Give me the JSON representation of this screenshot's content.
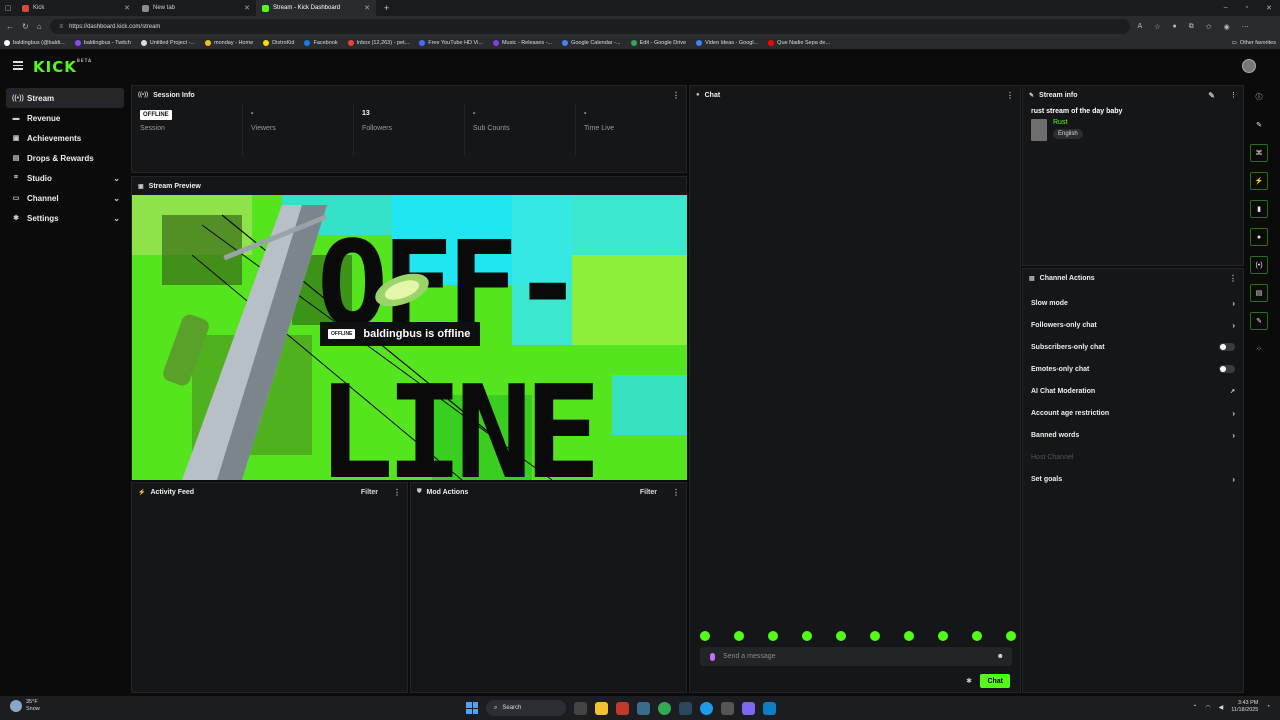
{
  "browser": {
    "tabs": [
      {
        "label": "Kick",
        "favicon_color": "#e0443b",
        "active": false
      },
      {
        "label": "New tab",
        "favicon_color": "#8a8a8a",
        "active": false
      },
      {
        "label": "Stream - Kick Dashboard",
        "favicon_color": "#53fc18",
        "active": true
      }
    ],
    "new_tab_symbol": "+",
    "url": "https://dashboard.kick.com/stream",
    "bookmarks": [
      {
        "label": "baldingbus (@baldi...",
        "color": "#ffffff"
      },
      {
        "label": "baldingbus - Twitch",
        "color": "#9146ff"
      },
      {
        "label": "Untitled Project -...",
        "color": "#dddddd"
      },
      {
        "label": "monday - Home",
        "color": "#f0c419"
      },
      {
        "label": "DistroKid",
        "color": "#ffdd00"
      },
      {
        "label": "Facebook",
        "color": "#1877f2"
      },
      {
        "label": "Inbox (12,263) - pet...",
        "color": "#ea4335"
      },
      {
        "label": "Free YouTube HD Vi...",
        "color": "#4a6cff"
      },
      {
        "label": "Music - Releases -...",
        "color": "#7b3fe4"
      },
      {
        "label": "Google Calendar -...",
        "color": "#4285f4"
      },
      {
        "label": "Edit - Google Drive",
        "color": "#34a853"
      },
      {
        "label": "Video Ideas - Googl...",
        "color": "#4285f4"
      },
      {
        "label": "Que Nadie Sepa de...",
        "color": "#ff0000"
      }
    ],
    "other_favorites": "Other favorites"
  },
  "sidebar": {
    "items": [
      {
        "label": "Stream",
        "icon": "broadcast-icon",
        "glyph": "((•))",
        "active": true,
        "expandable": false
      },
      {
        "label": "Revenue",
        "icon": "revenue-icon",
        "glyph": "▬",
        "active": false,
        "expandable": false
      },
      {
        "label": "Achievements",
        "icon": "trophy-icon",
        "glyph": "▣",
        "active": false,
        "expandable": false
      },
      {
        "label": "Drops & Rewards",
        "icon": "drops-icon",
        "glyph": "▤",
        "active": false,
        "expandable": false
      },
      {
        "label": "Studio",
        "icon": "studio-icon",
        "glyph": "⌗",
        "active": false,
        "expandable": true
      },
      {
        "label": "Channel",
        "icon": "channel-icon",
        "glyph": "▭",
        "active": false,
        "expandable": true
      },
      {
        "label": "Settings",
        "icon": "settings-icon",
        "glyph": "✱",
        "active": false,
        "expandable": true
      }
    ]
  },
  "session": {
    "title": "Session Info",
    "badge": "OFFLINE",
    "stats": [
      {
        "value": "",
        "label": "Session"
      },
      {
        "value": "-",
        "label": "Viewers"
      },
      {
        "value": "13",
        "label": "Followers"
      },
      {
        "value": "-",
        "label": "Sub Counts"
      },
      {
        "value": "-",
        "label": "Time Live"
      }
    ]
  },
  "preview": {
    "title": "Stream Preview",
    "badge": "OFFLINE",
    "offline_text": "baldingbus is offline",
    "art_line1": "OFF-",
    "art_line2": "LINE"
  },
  "activity": {
    "title": "Activity Feed",
    "filter": "Filter"
  },
  "mod": {
    "title": "Mod Actions",
    "filter": "Filter"
  },
  "chat": {
    "title": "Chat",
    "placeholder": "Send a message",
    "send_label": "Chat",
    "emote_count": 10
  },
  "stream_info": {
    "title": "Stream info",
    "stream_title": "rust stream of the day baby",
    "category": "Rust",
    "tag": "English"
  },
  "channel_actions": {
    "title": "Channel Actions",
    "items": [
      {
        "label": "Slow mode",
        "control": "chevron"
      },
      {
        "label": "Followers-only chat",
        "control": "chevron"
      },
      {
        "label": "Subscribers-only chat",
        "control": "toggle"
      },
      {
        "label": "Emotes-only chat",
        "control": "toggle"
      },
      {
        "label": "AI Chat Moderation",
        "control": "external"
      },
      {
        "label": "Account age restriction",
        "control": "chevron"
      },
      {
        "label": "Banned words",
        "control": "chevron"
      },
      {
        "label": "Host Channel",
        "control": "disabled"
      },
      {
        "label": "Set goals",
        "control": "chevron"
      }
    ]
  },
  "taskbar": {
    "temp": "35°F",
    "weather": "Snow",
    "search": "Search",
    "time": "3:43 PM",
    "date": "11/18/2025"
  },
  "colors": {
    "accent": "#53fc18",
    "panel": "#151618",
    "background": "#0b0b0c"
  }
}
